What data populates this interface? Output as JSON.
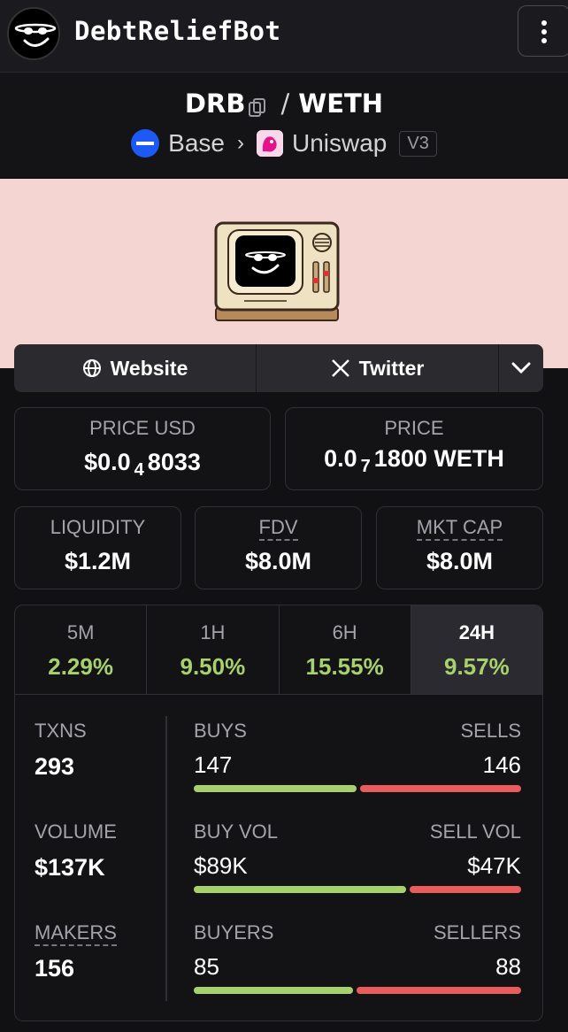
{
  "header": {
    "token_name": "DebtReliefBot",
    "menu_icon": "kebab-menu-icon"
  },
  "pair": {
    "base": "DRB",
    "quote": "WETH",
    "separator": "/",
    "chain": "Base",
    "dex": "Uniswap",
    "version": "V3"
  },
  "links": {
    "website_label": "Website",
    "twitter_label": "Twitter"
  },
  "stats": {
    "price_usd_label": "PRICE USD",
    "price_usd_prefix": "$0.0",
    "price_usd_zeros": "4",
    "price_usd_digits": "8033",
    "price_label": "PRICE",
    "price_prefix": "0.0",
    "price_zeros": "7",
    "price_digits": "1800 WETH",
    "liquidity_label": "LIQUIDITY",
    "liquidity_value": "$1.2M",
    "fdv_label": "FDV",
    "fdv_value": "$8.0M",
    "mktcap_label": "MKT CAP",
    "mktcap_value": "$8.0M"
  },
  "timeframes": [
    {
      "label": "5M",
      "change": "2.29%"
    },
    {
      "label": "1H",
      "change": "9.50%"
    },
    {
      "label": "6H",
      "change": "15.55%"
    },
    {
      "label": "24H",
      "change": "9.57%"
    }
  ],
  "details": {
    "txns_label": "TXNS",
    "txns_value": "293",
    "buys_label": "BUYS",
    "buys_value": "147",
    "sells_label": "SELLS",
    "sells_value": "146",
    "buys_fraction": 0.502,
    "volume_label": "VOLUME",
    "volume_value": "$137K",
    "buy_vol_label": "BUY VOL",
    "buy_vol_value": "$89K",
    "sell_vol_label": "SELL VOL",
    "sell_vol_value": "$47K",
    "buy_vol_fraction": 0.654,
    "makers_label": "MAKERS",
    "makers_value": "156",
    "buyers_label": "BUYERS",
    "buyers_value": "85",
    "sellers_label": "SELLERS",
    "sellers_value": "88",
    "buyers_fraction": 0.491
  },
  "colors": {
    "positive": "#a7d16c",
    "negative": "#ea5b5b",
    "banner": "#f5d5d2",
    "base_blue": "#1d59f5"
  }
}
